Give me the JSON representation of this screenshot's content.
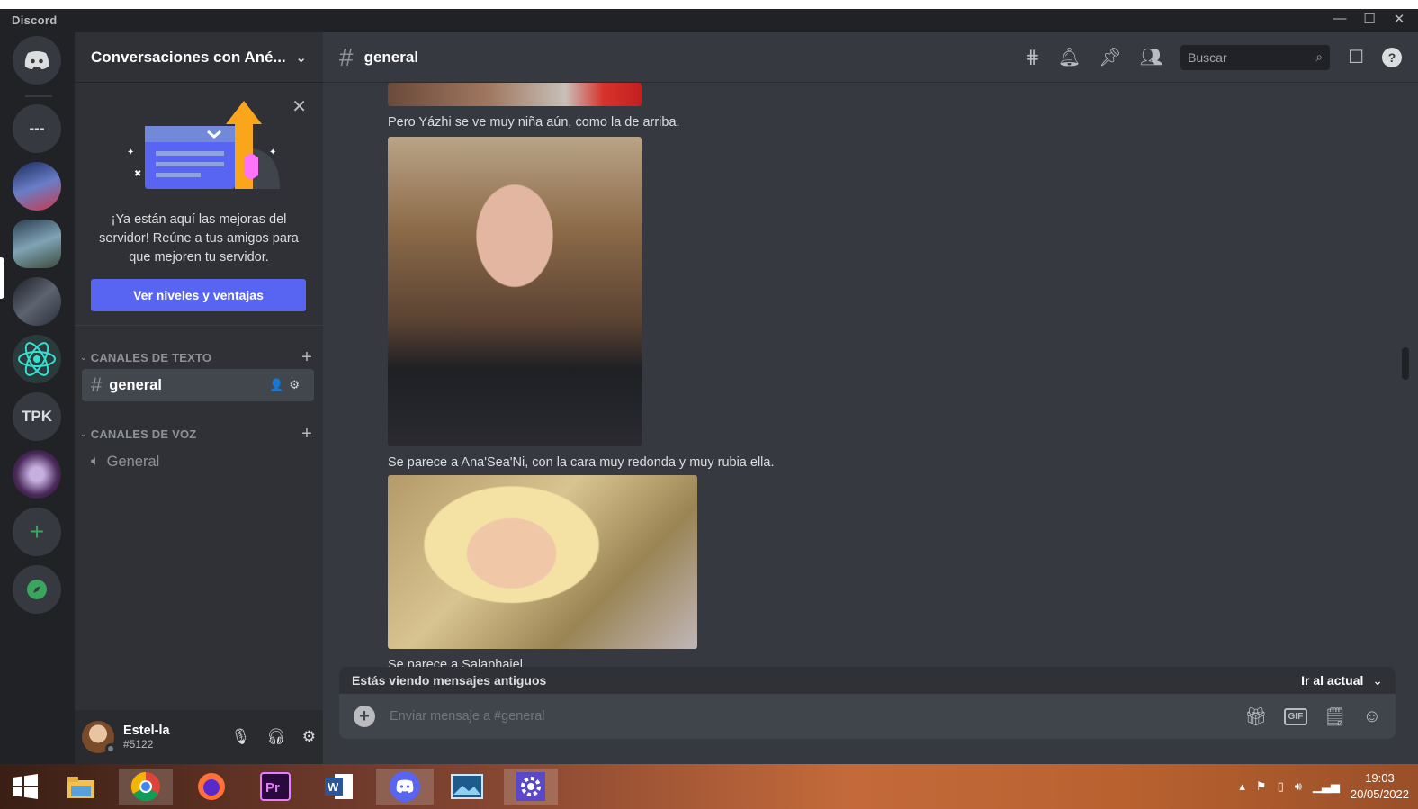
{
  "app": {
    "title": "Discord"
  },
  "window": {
    "minimize": "—",
    "maximize": "☐",
    "close": "✕"
  },
  "guilds": {
    "dm_icon": "discord-icon",
    "folder_label": "---",
    "tpk_label": "TPK",
    "add_label": "+",
    "explore_icon": "compass-icon"
  },
  "server": {
    "name": "Conversaciones con Ané...",
    "promo_text": "¡Ya están aquí las mejoras del servidor! Reúne a tus amigos para que mejoren tu servidor.",
    "promo_button": "Ver niveles y ventajas",
    "categories": {
      "text": "CANALES DE TEXTO",
      "voice": "CANALES DE VOZ"
    },
    "text_channel": "general",
    "voice_channel": "General"
  },
  "user": {
    "name": "Estel-la",
    "discriminator": "#5122"
  },
  "channel": {
    "name": "general",
    "search_placeholder": "Buscar"
  },
  "messages": [
    "Pero Yázhi se ve muy niña aún, como la de arriba.",
    "Se parece a Ana'Sea'Ni, con la cara muy redonda y muy rubia ella.",
    "Se parece a Salaphaiel"
  ],
  "old_messages_bar": {
    "label": "Estás viendo mensajes antiguos",
    "jump": "Ir al actual"
  },
  "composer": {
    "placeholder": "Enviar mensaje a #general",
    "gif_label": "GIF"
  },
  "taskbar": {
    "time": "19:03",
    "date": "20/05/2022"
  },
  "colors": {
    "blurple": "#5865f2",
    "bg": "#36393f",
    "sidebar": "#2f3136",
    "guilds": "#202225"
  }
}
